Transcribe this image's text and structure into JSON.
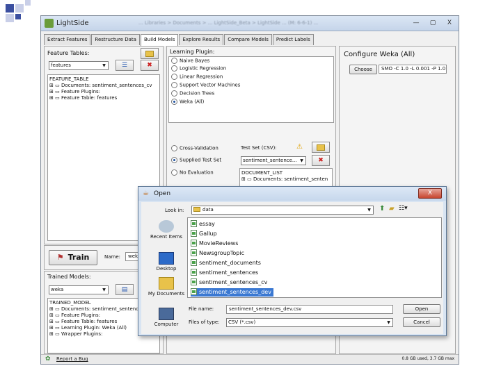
{
  "app": {
    "title": "LightSide",
    "blurred_title_path": "... Libraries > Documents > ... LightSide_Beta > LightSide ... (M: 6-6-1) ...",
    "window_buttons": {
      "minimize": "—",
      "maximize": "▢",
      "close": "X"
    }
  },
  "tabs": [
    {
      "label": "Extract Features",
      "active": false
    },
    {
      "label": "Restructure Data",
      "active": false
    },
    {
      "label": "Build Models",
      "active": true
    },
    {
      "label": "Explore Results",
      "active": false
    },
    {
      "label": "Compare Models",
      "active": false
    },
    {
      "label": "Predict Labels",
      "active": false
    }
  ],
  "left_panel": {
    "feature_tables_label": "Feature Tables:",
    "feature_table_select": "features",
    "tree_root": "FEATURE_TABLE",
    "tree_items": [
      "Documents: sentiment_sentences_cv",
      "Feature Plugins:",
      "Feature Table: features"
    ],
    "train_label": "Train",
    "name_label": "Name:",
    "name_value": "weka",
    "trained_models_label": "Trained Models:",
    "trained_models_select": "weka",
    "model_tree_root": "TRAINED_MODEL",
    "model_tree_items": [
      "Documents: sentiment_sentences",
      "Feature Plugins:",
      "Feature Table: features",
      "Learning Plugin: Weka (All)",
      "Wrapper Plugins:"
    ]
  },
  "middle_panel": {
    "learning_plugin_label": "Learning Plugin:",
    "learning_plugins": [
      {
        "label": "Naive Bayes",
        "selected": false
      },
      {
        "label": "Logistic Regression",
        "selected": false
      },
      {
        "label": "Linear Regression",
        "selected": false
      },
      {
        "label": "Support Vector Machines",
        "selected": false
      },
      {
        "label": "Decision Trees",
        "selected": false
      },
      {
        "label": "Weka (All)",
        "selected": true
      }
    ],
    "evaluation_options": [
      {
        "label": "Cross-Validation",
        "selected": false
      },
      {
        "label": "Supplied Test Set",
        "selected": true
      },
      {
        "label": "No Evaluation",
        "selected": false
      }
    ],
    "test_set_label": "Test Set (CSV):",
    "test_set_select": "sentiment_sentence...",
    "document_list_root": "DOCUMENT_LIST",
    "document_list_items": [
      "Documents: sentiment_senten"
    ]
  },
  "right_panel": {
    "title": "Configure Weka (All)",
    "choose_label": "Choose",
    "classifier_value": "SMO -C 1.0 -L 0.001 -P 1.0"
  },
  "status_bar": {
    "report_bug": "Report a Bug",
    "memory": "0.8 GB used, 3.7 GB max"
  },
  "open_dialog": {
    "title": "Open",
    "look_in_label": "Look in:",
    "look_in_value": "data",
    "places": [
      "Recent Items",
      "Desktop",
      "My Documents",
      "Computer"
    ],
    "files": [
      {
        "name": "essay",
        "selected": false
      },
      {
        "name": "Gallup",
        "selected": false
      },
      {
        "name": "MovieReviews",
        "selected": false
      },
      {
        "name": "NewsgroupTopic",
        "selected": false
      },
      {
        "name": "sentiment_documents",
        "selected": false
      },
      {
        "name": "sentiment_sentences",
        "selected": false
      },
      {
        "name": "sentiment_sentences_cv",
        "selected": false
      },
      {
        "name": "sentiment_sentences_dev",
        "selected": true
      }
    ],
    "file_name_label": "File name:",
    "file_name_value": "sentiment_sentences_dev.csv",
    "files_of_type_label": "Files of type:",
    "files_of_type_value": "CSV (*.csv)",
    "open_button": "Open",
    "cancel_button": "Cancel"
  },
  "colors": {
    "accent_selection": "#3a78d2",
    "titlebar": "#c5d5ea",
    "close_red": "#c7452f"
  }
}
